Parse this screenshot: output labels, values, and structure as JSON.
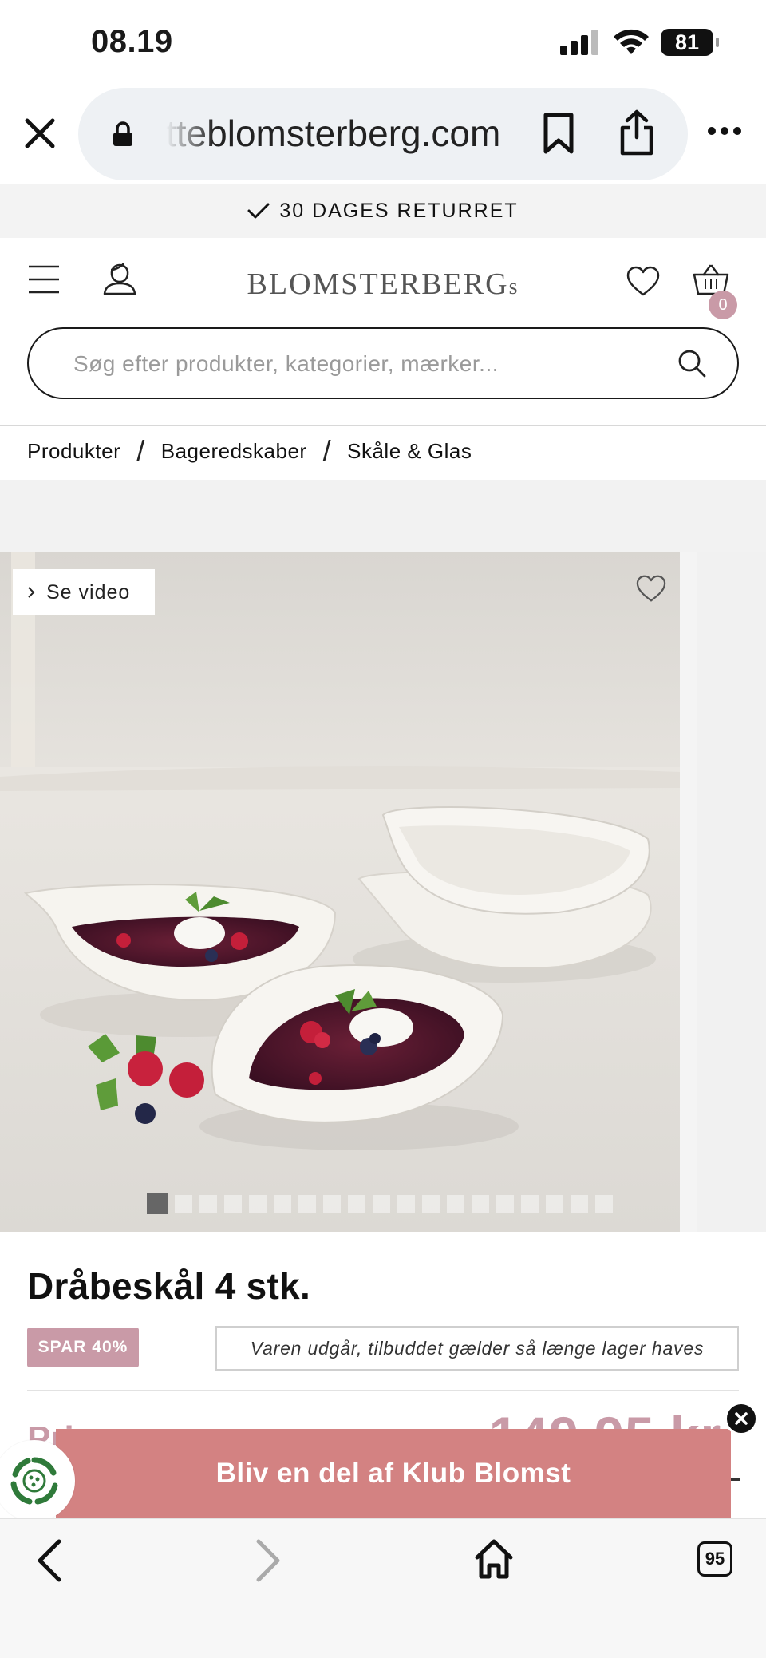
{
  "status_bar": {
    "time": "08.19",
    "battery": "81"
  },
  "browser": {
    "url": "tteblomsterberg.com",
    "icons": [
      "close-icon",
      "lock-icon",
      "bookmark-icon",
      "share-icon",
      "more-icon"
    ]
  },
  "promo": {
    "text": "30 DAGES RETURRET",
    "icon": "checkmark-icon"
  },
  "header": {
    "logo": "BLOMSTERBERG",
    "logo_suffix": "s",
    "cart_count": "0",
    "icons": [
      "menu-icon",
      "account-icon",
      "heart-icon",
      "basket-icon"
    ]
  },
  "search": {
    "placeholder": "Søg efter produkter, kategorier, mærker..."
  },
  "breadcrumb": {
    "items": [
      "Produkter",
      "Bageredskaber",
      "Skåle & Glas"
    ],
    "separator": "/"
  },
  "gallery": {
    "video_label": "Se video",
    "image_count": 19,
    "active_index": 1
  },
  "product": {
    "title": "Dråbeskål 4 stk.",
    "save_badge": "SPAR 40%",
    "notice": "Varen udgår, tilbuddet gælder så længe lager haves",
    "price_label": "Pris",
    "price": "149,95 kr."
  },
  "banner": {
    "text": "Bliv en del af Klub Blomst"
  },
  "bottom_nav": {
    "tabs_count": "95"
  },
  "colors": {
    "accent_pink": "#c99aa7",
    "banner_red": "#d38282",
    "loyalty_green": "#2f7a3a"
  }
}
